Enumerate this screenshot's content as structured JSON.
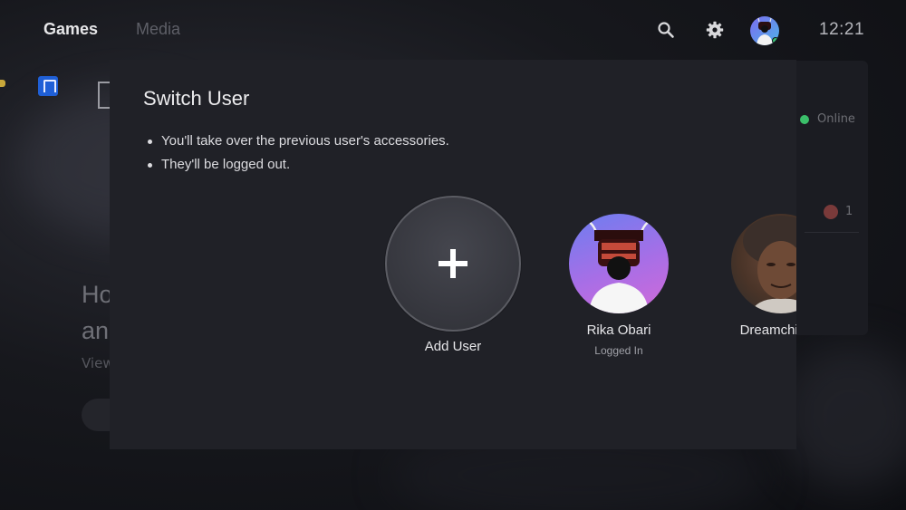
{
  "topbar": {
    "tabs": [
      {
        "label": "Games",
        "active": true
      },
      {
        "label": "Media",
        "active": false
      }
    ],
    "time": "12:21",
    "icons": [
      "search-icon",
      "gear-icon",
      "profile-avatar"
    ]
  },
  "background": {
    "heading_line1": "Ho",
    "heading_line2": "an",
    "view_link": "View",
    "online_status": "Online",
    "trophy_count": "1"
  },
  "dialog": {
    "title": "Switch User",
    "bullets": [
      "You'll take over the previous user's accessories.",
      "They'll be logged out."
    ],
    "users": [
      {
        "name": "Add User",
        "status": "",
        "type": "add"
      },
      {
        "name": "Rika Obari",
        "status": "Logged In",
        "type": "user"
      },
      {
        "name": "Dreamchild C",
        "status": "",
        "type": "user"
      }
    ]
  },
  "colors": {
    "background": "#111217",
    "panel": "#202127",
    "online_green": "#3bbf6a",
    "store_blue": "#1f5fd6"
  }
}
